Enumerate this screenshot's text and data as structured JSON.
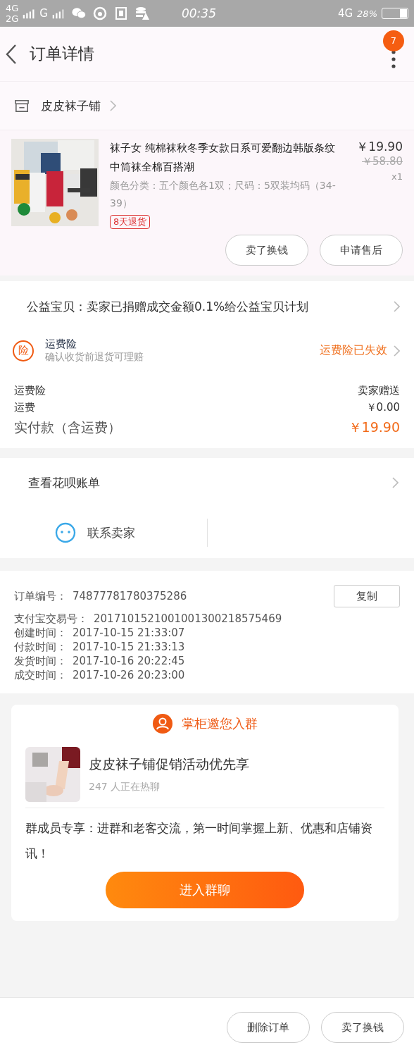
{
  "status_bar": {
    "network_1": "4G",
    "network_2": "2G",
    "network_3": "G",
    "time": "00:35",
    "network_right": "4G",
    "battery": "28%"
  },
  "header": {
    "title": "订单详情",
    "badge": "7"
  },
  "shop": {
    "name": "皮皮袜子铺"
  },
  "product": {
    "kind": "picture",
    "title": "袜子女 纯棉袜秋冬季女款日系可爱翻边韩版条纹中筒袜全棉百搭潮",
    "spec": "颜色分类：五个颜色各1双；尺码：5双装均码（34-39）",
    "tag": "8天退货",
    "price": "￥19.90",
    "original_price": "￥58.80",
    "quantity": "x1",
    "buttons": [
      "卖了换钱",
      "申请售后"
    ]
  },
  "charity": {
    "text": "公益宝贝：卖家已捐赠成交金额0.1%给公益宝贝计划"
  },
  "insurance": {
    "icon_text": "险",
    "title": "运费险",
    "subtitle": "确认收货前退货可理赔",
    "status": "运费险已失效"
  },
  "fees": [
    {
      "kind": "normal",
      "label": "运费险",
      "value": "卖家赠送"
    },
    {
      "kind": "normal",
      "label": "运费",
      "value": "￥0.00"
    },
    {
      "kind": "total",
      "label": "实付款（含运费）",
      "value": "￥19.90"
    }
  ],
  "huabei": {
    "text": "查看花呗账单"
  },
  "contact": {
    "label": "联系卖家"
  },
  "order_info": {
    "copy_button": "复制",
    "rows": [
      {
        "label": "订单编号：",
        "value": "74877781780375286"
      },
      {
        "label": "支付宝交易号：",
        "value": "2017101521001001300218575469"
      },
      {
        "label": "创建时间：",
        "value": "2017-10-15 21:33:07"
      },
      {
        "label": "付款时间：",
        "value": "2017-10-15 21:33:13"
      },
      {
        "label": "发货时间：",
        "value": "2017-10-16 20:22:45"
      },
      {
        "label": "成交时间：",
        "value": "2017-10-26 20:23:00"
      }
    ]
  },
  "group_card": {
    "title": "掌柜邀您入群",
    "group_name": "皮皮袜子铺促销活动优先享",
    "members": "247 人正在热聊",
    "description": "群成员专享：进群和老客交流，第一时间掌握上新、优惠和店铺资讯！",
    "button": "进入群聊"
  },
  "bottom_buttons": [
    "删除订单",
    "卖了换钱"
  ]
}
